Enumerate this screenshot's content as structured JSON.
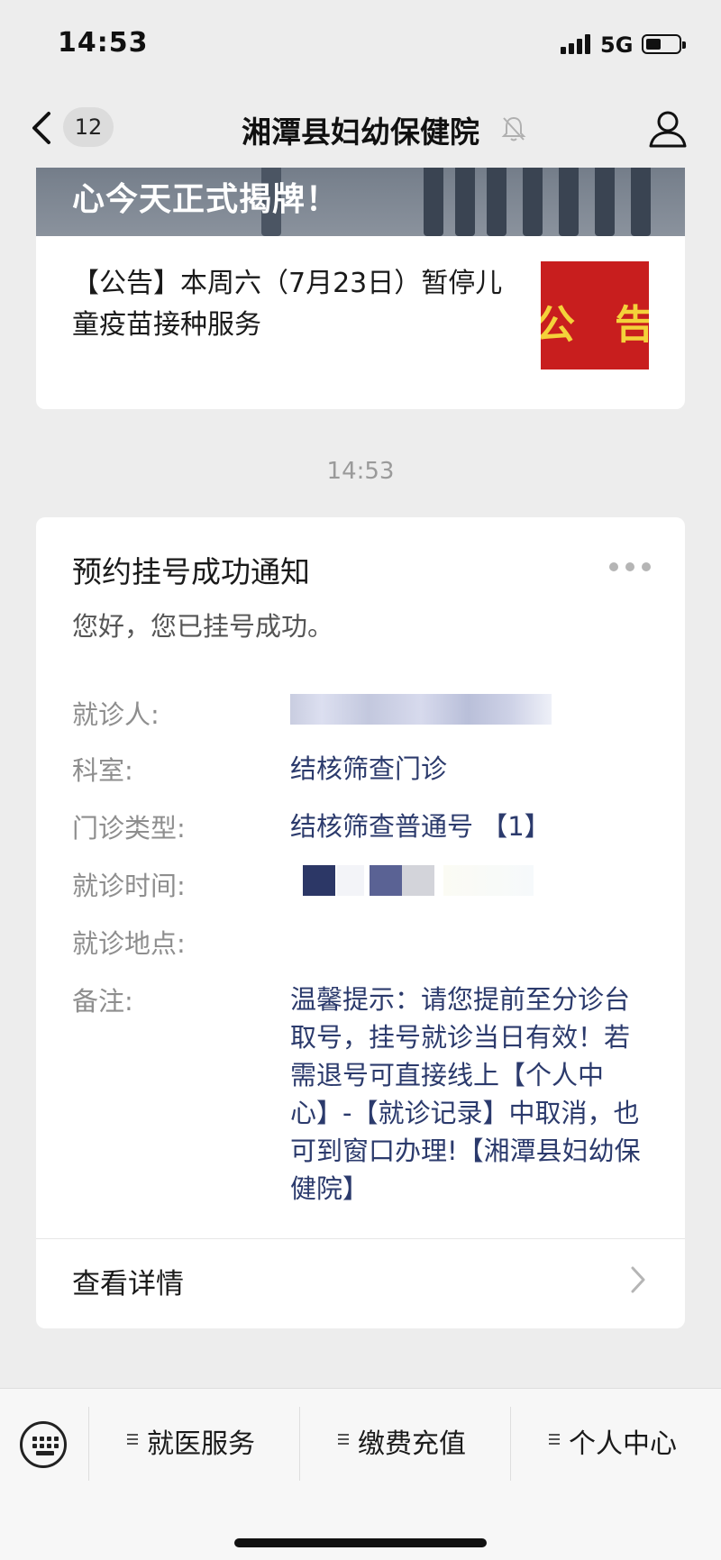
{
  "status_bar": {
    "time": "14:53",
    "network": "5G"
  },
  "nav": {
    "unread_count": "12",
    "title": "湘潭县妇幼保健院"
  },
  "article_card": {
    "cover_headline": "心今天正式揭牌！",
    "title": "【公告】本周六（7月23日）暂停儿童疫苗接种服务",
    "thumb_text": "公 告"
  },
  "timestamp": "14:53",
  "notice": {
    "title": "预约挂号成功通知",
    "greeting": "您好，您已挂号成功。",
    "fields": [
      {
        "label": "就诊人:",
        "value": ""
      },
      {
        "label": "科室:",
        "value": "结核筛查门诊"
      },
      {
        "label": "门诊类型:",
        "value": "结核筛查普通号 【1】"
      },
      {
        "label": "就诊时间:",
        "value": ""
      },
      {
        "label": "就诊地点:",
        "value": ""
      },
      {
        "label": "备注:",
        "value": "温馨提示：请您提前至分诊台取号，挂号就诊当日有效！若需退号可直接线上【个人中心】-【就诊记录】中取消，也可到窗口办理!【湘潭县妇幼保健院】"
      }
    ],
    "detail_label": "查看详情"
  },
  "bottom_menu": {
    "items": [
      {
        "label": "就医服务"
      },
      {
        "label": "缴费充值"
      },
      {
        "label": "个人中心"
      }
    ]
  },
  "colors": {
    "background": "#ededed",
    "card": "#ffffff",
    "value_text": "#2b3a6c",
    "label_text": "#8e8e8e",
    "thumb_red": "#c81e1e"
  }
}
